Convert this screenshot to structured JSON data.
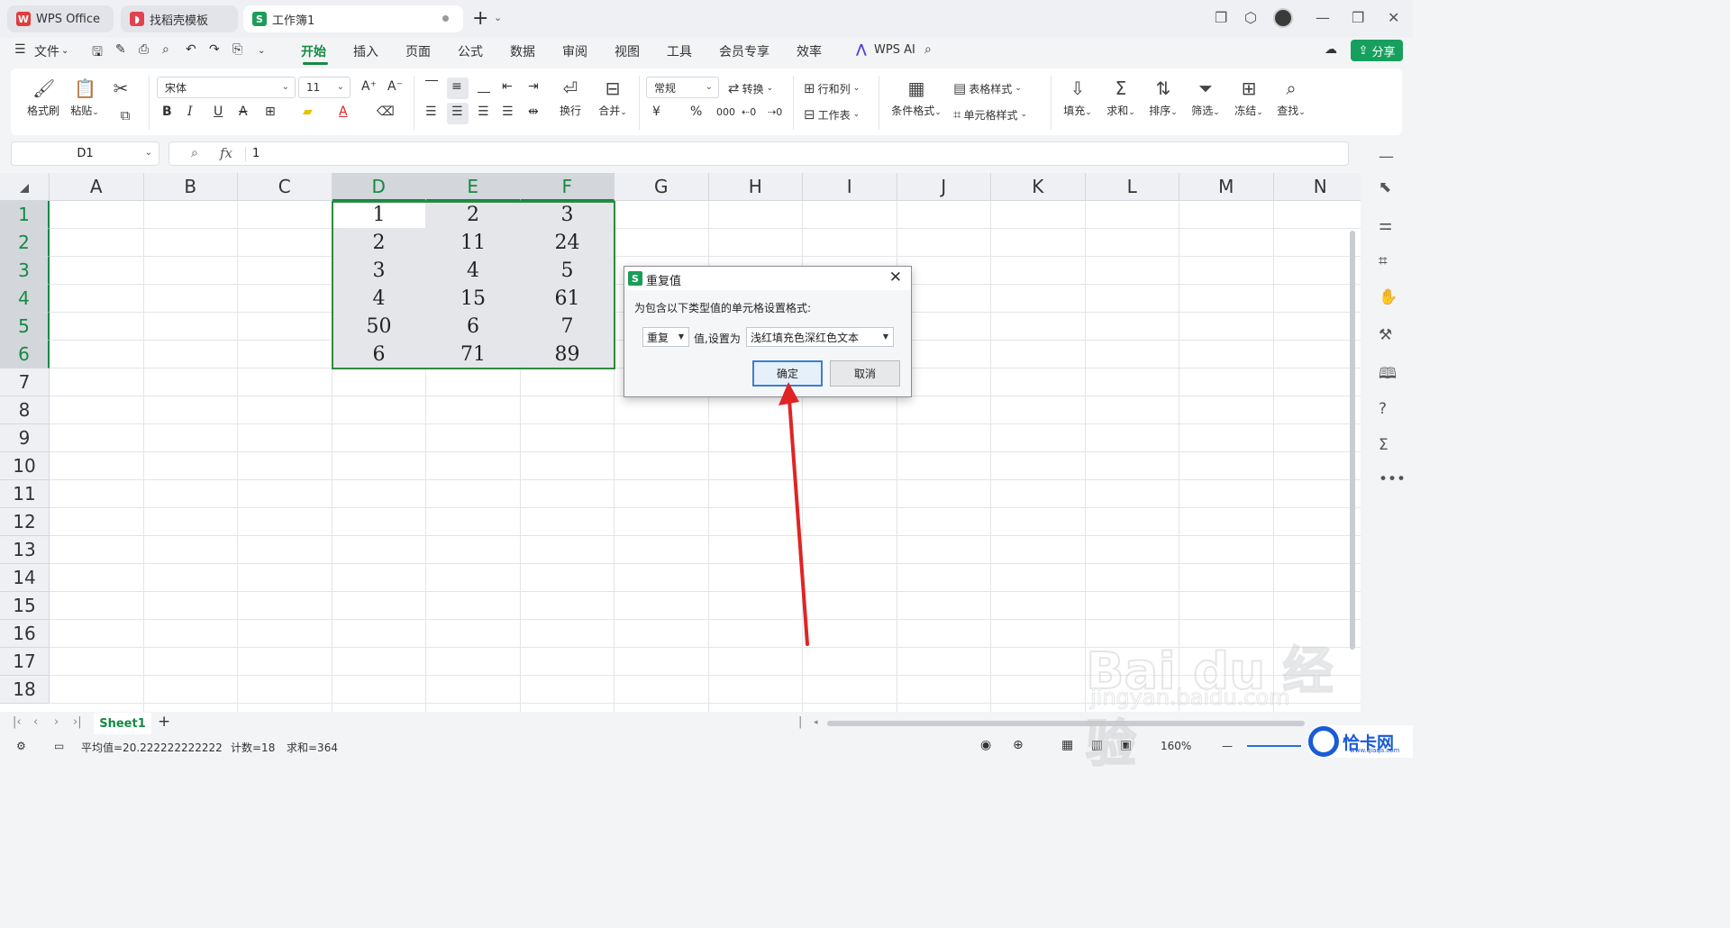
{
  "tabs": [
    {
      "label": "WPS Office",
      "icon": "wps-logo-icon",
      "color": "#e33b3b"
    },
    {
      "label": "找稻壳模板",
      "icon": "docer-icon",
      "color": "#e0434f"
    },
    {
      "label": "工作簿1",
      "icon": "spreadsheet-icon",
      "color": "#1b9d57"
    }
  ],
  "menu": {
    "file": "文件",
    "items": [
      "开始",
      "插入",
      "页面",
      "公式",
      "数据",
      "审阅",
      "视图",
      "工具",
      "会员专享",
      "效率"
    ],
    "active": "开始",
    "wps_ai": "WPS AI",
    "share": "分享"
  },
  "ribbon": {
    "format_painter": "格式刷",
    "paste": "粘贴",
    "font_name": "宋体",
    "font_size": "11",
    "wrap": "换行",
    "merge": "合并",
    "number_format": "常规",
    "convert": "转换",
    "rows_cols": "行和列",
    "worksheet": "工作表",
    "cond_format": "条件格式",
    "table_style": "表格样式",
    "cell_style": "单元格样式",
    "fill": "填充",
    "sum": "求和",
    "sort": "排序",
    "filter": "筛选",
    "freeze": "冻结",
    "find": "查找",
    "currency_symbol": "¥",
    "percent_symbol": "%",
    "thousands_symbol": "000"
  },
  "formula_bar": {
    "name_box": "D1",
    "fx": "fx",
    "value": "1"
  },
  "grid": {
    "columns": [
      "A",
      "B",
      "C",
      "D",
      "E",
      "F",
      "G",
      "H",
      "I",
      "J",
      "K",
      "L",
      "M",
      "N"
    ],
    "rows": [
      "1",
      "2",
      "3",
      "4",
      "5",
      "6",
      "7",
      "8",
      "9",
      "10",
      "11",
      "12",
      "13",
      "14",
      "15",
      "16",
      "17",
      "18"
    ],
    "data": [
      [
        "1",
        "2",
        "3"
      ],
      [
        "2",
        "11",
        "24"
      ],
      [
        "3",
        "4",
        "5"
      ],
      [
        "4",
        "15",
        "61"
      ],
      [
        "50",
        "6",
        "7"
      ],
      [
        "6",
        "71",
        "89"
      ]
    ]
  },
  "dialog": {
    "title": "重复值",
    "description": "为包含以下类型值的单元格设置格式:",
    "type_value": "重复",
    "middle_text": "值,设置为",
    "format_value": "浅红填充色深红色文本",
    "ok": "确定",
    "cancel": "取消"
  },
  "sheets": {
    "active": "Sheet1",
    "add": "+"
  },
  "status": {
    "average": "平均值=20.222222222222",
    "count": "计数=18",
    "sum": "求和=364",
    "zoom": "160%"
  },
  "watermark": {
    "brand": "Bai du 经验",
    "url": "jingyan.baidu.com",
    "site": "恰卡网",
    "site_url": "www.qiaqa.com"
  },
  "colors": {
    "accent": "#148a43",
    "selection_border": "#2e8b3d",
    "share_button": "#17a05d",
    "arrow": "#e02424"
  }
}
